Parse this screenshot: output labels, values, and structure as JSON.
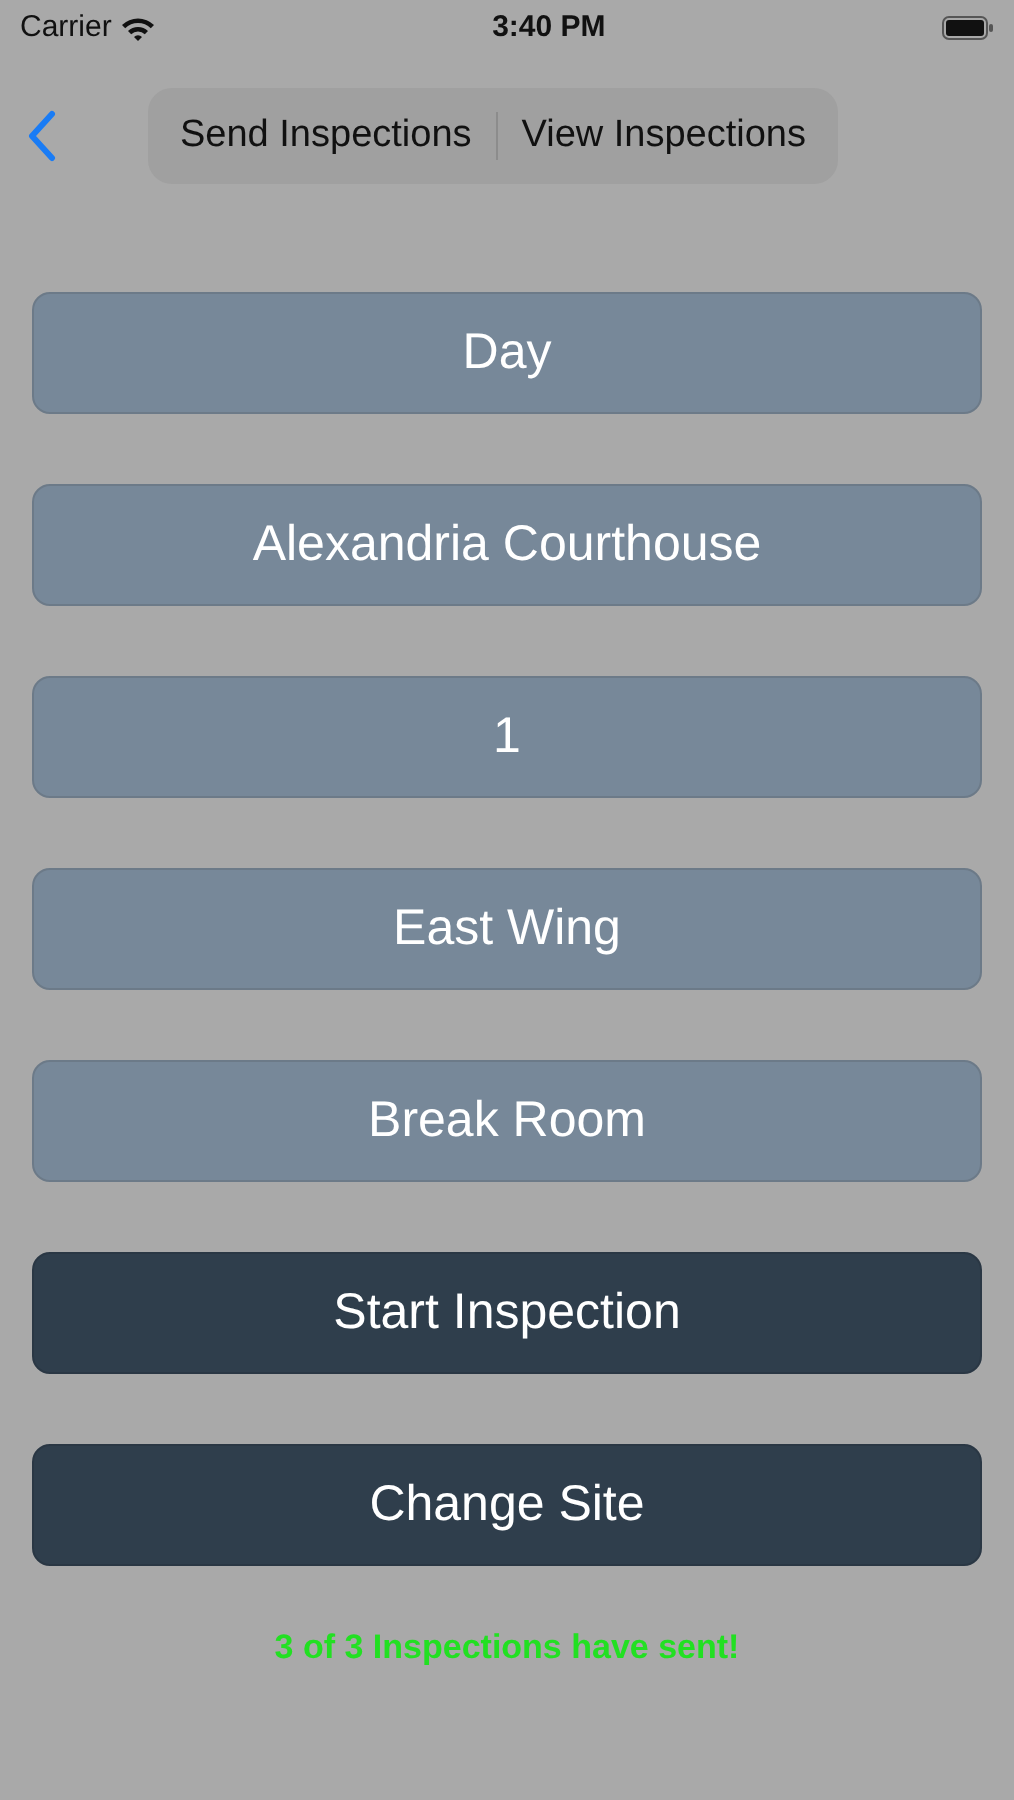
{
  "status_bar": {
    "carrier": "Carrier",
    "time": "3:40 PM"
  },
  "segments": [
    {
      "label": "Send Inspections",
      "selected": false
    },
    {
      "label": "View Inspections",
      "selected": false
    }
  ],
  "buttons": [
    {
      "label": "Day",
      "kind": "field"
    },
    {
      "label": "Alexandria Courthouse",
      "kind": "field"
    },
    {
      "label": "1",
      "kind": "field"
    },
    {
      "label": "East Wing",
      "kind": "field"
    },
    {
      "label": "Break Room",
      "kind": "field"
    },
    {
      "label": "Start Inspection",
      "kind": "action"
    },
    {
      "label": "Change Site",
      "kind": "action"
    }
  ],
  "message": "3 of 3 Inspections have sent!"
}
